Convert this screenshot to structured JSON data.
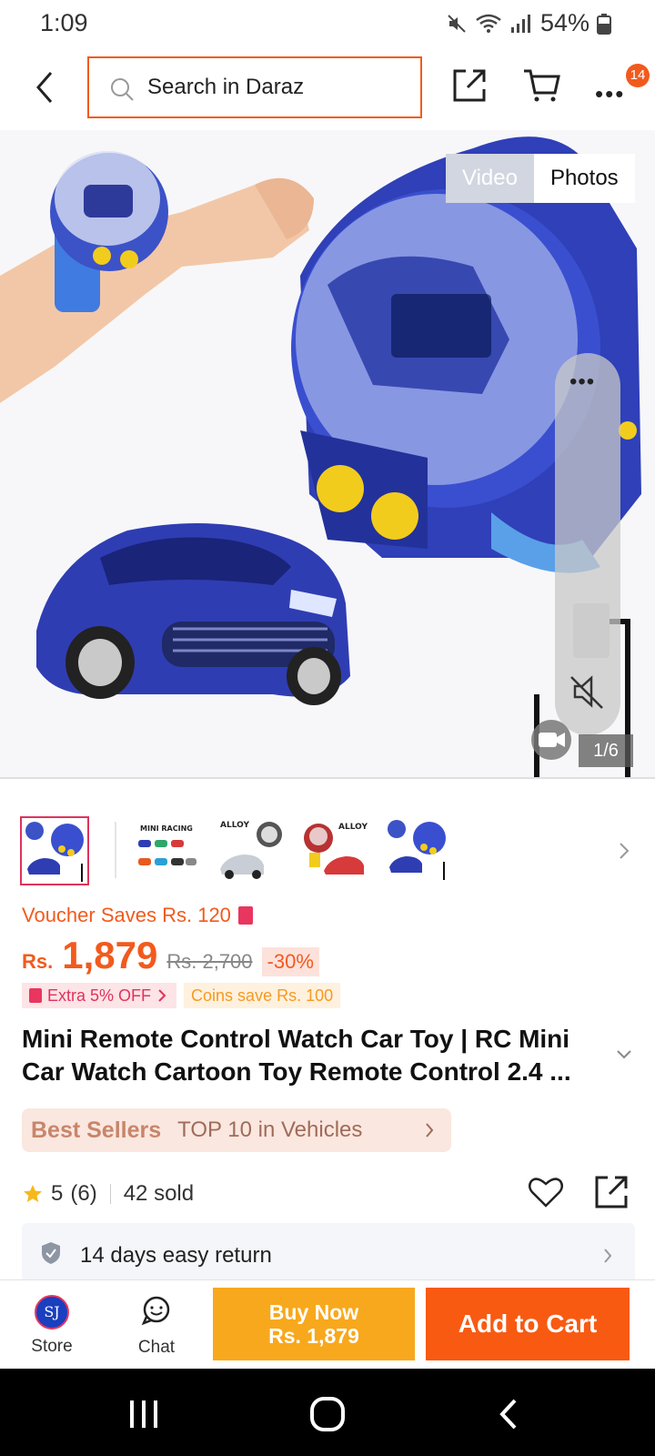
{
  "status": {
    "time": "1:09",
    "battery": "54%"
  },
  "header": {
    "search_placeholder": "Search in Daraz",
    "cart_badge": "14"
  },
  "media": {
    "video_tab": "Video",
    "photos_tab": "Photos",
    "counter": "1/6"
  },
  "price": {
    "voucher": "Voucher Saves Rs. 120",
    "currency": "Rs.",
    "current": "1,879",
    "original": "Rs. 2,700",
    "discount": "-30%",
    "promo_extra": "Extra 5% OFF",
    "promo_coins": "Coins save Rs. 100"
  },
  "product": {
    "title": "Mini Remote Control Watch Car Toy | RC Mini Car Watch Cartoon Toy Remote Control 2.4 ...",
    "bestsellers_label": "Best Sellers",
    "bestsellers_rank": "TOP 10 in Vehicles",
    "rating": "5",
    "rating_count": "(6)",
    "sold": "42 sold",
    "return_policy": "14 days easy return"
  },
  "thumbnails": [
    {
      "label": ""
    },
    {
      "label": "MINI RACING"
    },
    {
      "label": "ALLOY"
    },
    {
      "label": "ALLOY"
    },
    {
      "label": ""
    }
  ],
  "actions": {
    "store_avatar": "SJ",
    "store_label": "Store",
    "chat_label": "Chat",
    "buy_now_line1": "Buy Now",
    "buy_now_line2": "Rs. 1,879",
    "add_to_cart": "Add to Cart"
  },
  "icons": {
    "back": "chevron-left-icon",
    "search": "search-icon",
    "share": "share-icon",
    "cart": "cart-icon",
    "more": "more-icon",
    "star": "star-icon",
    "heart": "heart-icon",
    "shield": "shield-icon"
  },
  "colors": {
    "accent": "#f25a1d",
    "buy_now": "#f8a81c",
    "add_to_cart": "#f85a12",
    "price": "#f25a1d",
    "voucher_tag": "#e8365f"
  }
}
